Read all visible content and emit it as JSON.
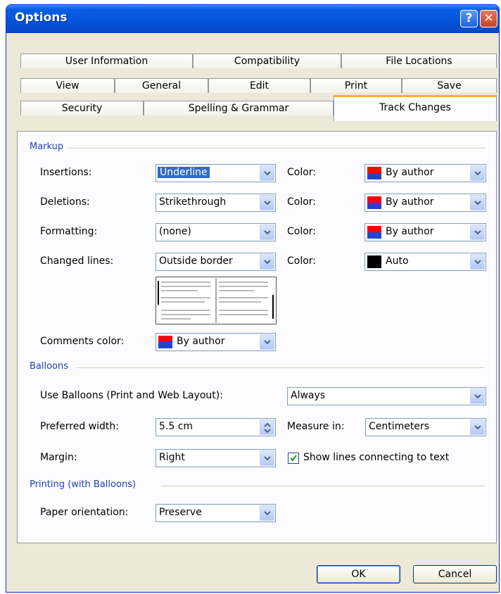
{
  "window": {
    "title": "Options",
    "help_glyph": "?",
    "close_glyph": "✕"
  },
  "tabs": {
    "row1": [
      "User Information",
      "Compatibility",
      "File Locations"
    ],
    "row2": [
      "View",
      "General",
      "Edit",
      "Print",
      "Save"
    ],
    "row3": [
      "Security",
      "Spelling & Grammar",
      "Track Changes"
    ],
    "active": "Track Changes"
  },
  "markup": {
    "section_title": "Markup",
    "insertions": {
      "label": "Insertions:",
      "value": "Underline",
      "color_label": "Color:",
      "color_value": "By author"
    },
    "deletions": {
      "label": "Deletions:",
      "value": "Strikethrough",
      "color_label": "Color:",
      "color_value": "By author"
    },
    "formatting": {
      "label": "Formatting:",
      "value": "(none)",
      "color_label": "Color:",
      "color_value": "By author"
    },
    "changed_lines": {
      "label": "Changed lines:",
      "value": "Outside border",
      "color_label": "Color:",
      "color_value": "Auto"
    },
    "comments_color": {
      "label": "Comments color:",
      "value": "By author"
    }
  },
  "balloons": {
    "section_title": "Balloons",
    "use_balloons": {
      "label": "Use Balloons (Print and Web Layout):",
      "value": "Always"
    },
    "preferred_width": {
      "label": "Preferred width:",
      "value": "5.5 cm"
    },
    "measure_in": {
      "label": "Measure in:",
      "value": "Centimeters"
    },
    "margin": {
      "label": "Margin:",
      "value": "Right"
    },
    "show_lines": {
      "label": "Show lines connecting to text",
      "checked": true
    }
  },
  "printing": {
    "section_title": "Printing (with Balloons)",
    "paper_orientation": {
      "label": "Paper orientation:",
      "value": "Preserve"
    }
  },
  "buttons": {
    "ok": "OK",
    "cancel": "Cancel"
  },
  "colors": {
    "titlebar": "#0453d6",
    "section_text": "#1d3fb9",
    "dialog_bg": "#ece9d8",
    "active_tab_accent": "#f6b23a",
    "selection": "#316ac5"
  }
}
